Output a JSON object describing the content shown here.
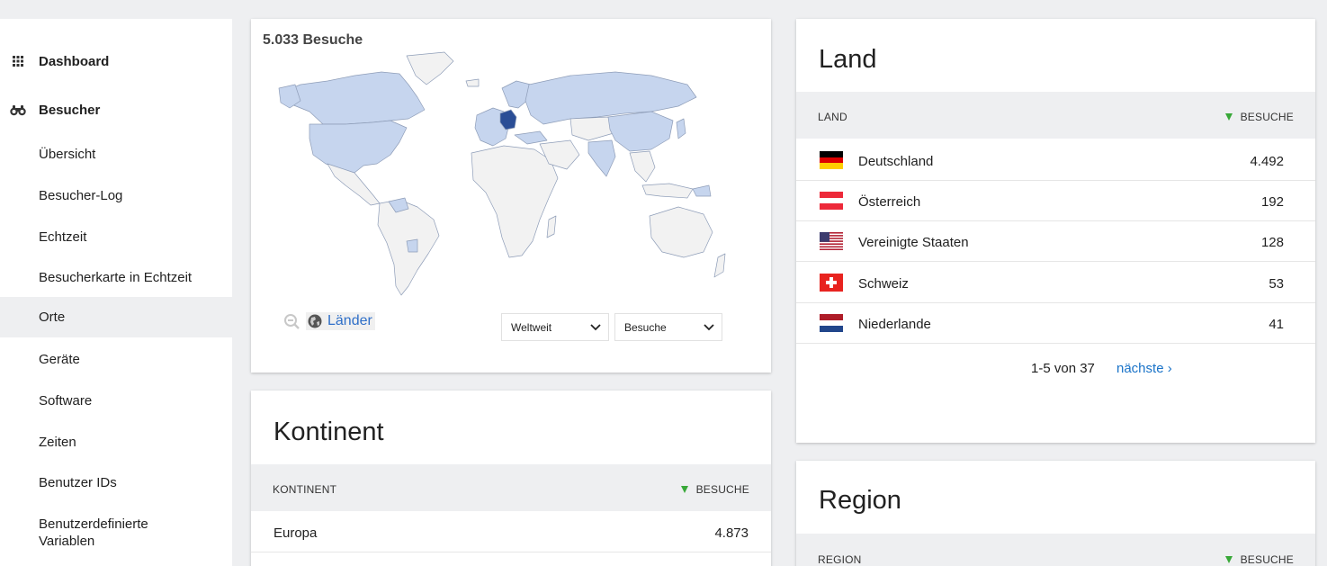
{
  "sidebar": {
    "dashboard": "Dashboard",
    "visitors": "Besucher",
    "items": [
      "Übersicht",
      "Besucher-Log",
      "Echtzeit",
      "Besucherkarte in Echtzeit",
      "Orte",
      "Geräte",
      "Software",
      "Zeiten",
      "Benutzer IDs",
      "Benutzerdefinierte Variablen"
    ],
    "active_item": "Orte",
    "icons": {
      "dashboard": "grid-icon",
      "visitors": "binoculars-icon"
    }
  },
  "map": {
    "title": "5.033 Besuche",
    "countries_label": "Länder",
    "region_select": "Weltweit",
    "metric_select": "Besuche",
    "colors": {
      "highlight_dark": "#2a4e96",
      "highlight_light": "#c6d5ee",
      "neutral": "#f2f2f2",
      "border": "#8e9db8"
    }
  },
  "continent": {
    "title": "Kontinent",
    "col_label": "KONTINENT",
    "col_metric": "BESUCHE",
    "rows": [
      {
        "name": "Europa",
        "value": "4.873"
      }
    ]
  },
  "country": {
    "title": "Land",
    "col_label": "LAND",
    "col_metric": "BESUCHE",
    "rows": [
      {
        "name": "Deutschland",
        "value": "4.492",
        "flag": "de"
      },
      {
        "name": "Österreich",
        "value": "192",
        "flag": "at"
      },
      {
        "name": "Vereinigte Staaten",
        "value": "128",
        "flag": "us"
      },
      {
        "name": "Schweiz",
        "value": "53",
        "flag": "ch"
      },
      {
        "name": "Niederlande",
        "value": "41",
        "flag": "nl"
      }
    ],
    "pager": {
      "count": "1-5 von 37",
      "next": "nächste ›"
    }
  },
  "region": {
    "title": "Region",
    "col_label": "REGION",
    "col_metric": "BESUCHE"
  },
  "accent": {
    "sort_arrow": "#38a838",
    "link": "#1a73c8"
  }
}
